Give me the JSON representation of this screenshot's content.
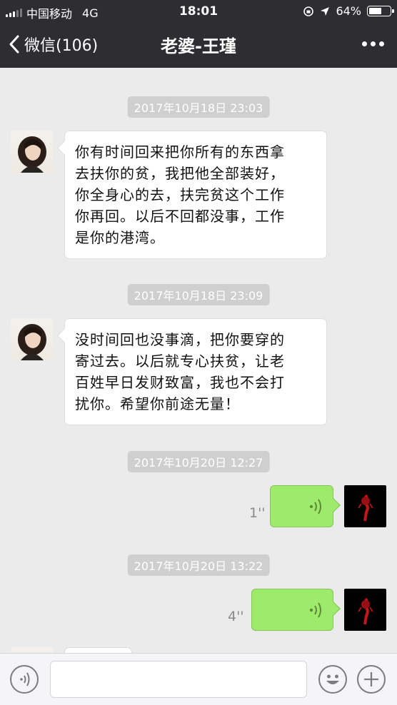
{
  "status_bar": {
    "carrier": "中国移动",
    "network": "4G",
    "time": "18:01",
    "battery": "64%",
    "battery_level": 0.64
  },
  "nav": {
    "back_label": "微信(106)",
    "title": "老婆-王瑾"
  },
  "messages": [
    {
      "timestamp": "2017年10月18日 23:03",
      "lines": [
        "你有时间回来把你所有的东西拿",
        "去扶你的贫，我把他全部装好，",
        "你全身心的去，扶完贫这个工作",
        "你再回。以后不回都没事，工作",
        "是你的港湾。"
      ]
    },
    {
      "timestamp": "2017年10月18日 23:09",
      "lines": [
        "没时间回也没事滴，把你要穿的",
        "寄过去。以后就专心扶贫，让老",
        "百姓早日发财致富，我也不会打",
        "扰你。希望你前途无量！"
      ]
    },
    {
      "timestamp": "2017年10月20日 12:27",
      "voice_duration": "1''"
    },
    {
      "timestamp": "2017年10月20日 13:22",
      "voice_duration": "4''"
    }
  ],
  "colors": {
    "nav_bg": "#2e2e32",
    "chat_bg": "#ebebeb",
    "voice_bubble": "#9eea6a"
  },
  "icons": [
    "back-chevron-icon",
    "more-dots-icon",
    "voice-toggle-icon",
    "sound-wave-icon",
    "emoji-icon",
    "plus-icon"
  ]
}
